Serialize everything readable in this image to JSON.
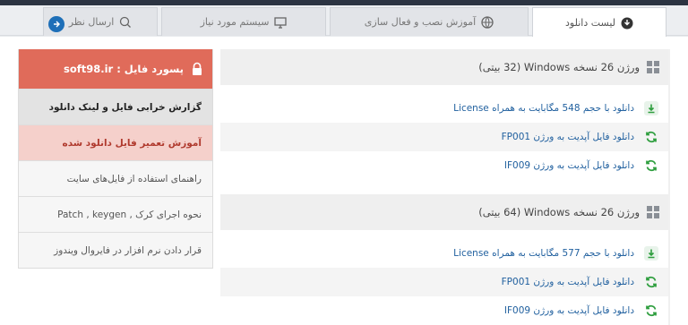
{
  "tabs": [
    {
      "label": "لیست دانلود",
      "icon": "download-circle-icon",
      "active": true
    },
    {
      "label": "آموزش نصب و فعال سازی",
      "icon": "globe-icon",
      "active": false
    },
    {
      "label": "سیستم مورد نیاز",
      "icon": "monitor-icon",
      "active": false
    },
    {
      "label": "ارسال نظر",
      "icon": "chat-icon",
      "active": false
    }
  ],
  "sidebar": {
    "password_label": "پسورد فایل : soft98.ir",
    "items": [
      {
        "label": "گزارش خرابی فایل و لینک دانلود",
        "style": "bold"
      },
      {
        "label": "آموزش تعمیر فایل دانلود شده",
        "style": "pink"
      },
      {
        "label": "راهنمای استفاده از فایل‌های سایت",
        "style": "plain"
      },
      {
        "label": "نحوه اجرای کرک , Patch , keygen",
        "style": "plain"
      },
      {
        "label": "قرار دادن نرم افزار در فایروال ویندوز",
        "style": "plain"
      }
    ]
  },
  "sections": [
    {
      "title": "ورژن 26 نسخه Windows (32 بیتی)",
      "items": [
        {
          "label": "دانلود با حجم 548 مگابایت به همراه License",
          "icon": "download-icon"
        },
        {
          "label": "دانلود فایل آپدیت به ورژن FP001",
          "icon": "refresh-icon"
        },
        {
          "label": "دانلود فایل آپدیت به ورژن IF009",
          "icon": "refresh-icon"
        }
      ]
    },
    {
      "title": "ورژن 26 نسخه Windows (64 بیتی)",
      "items": [
        {
          "label": "دانلود با حجم 577 مگابایت به همراه License",
          "icon": "download-icon"
        },
        {
          "label": "دانلود فایل آپدیت به ورژن FP001",
          "icon": "refresh-icon"
        },
        {
          "label": "دانلود فایل آپدیت به ورژن IF009",
          "icon": "refresh-icon"
        }
      ]
    }
  ],
  "colors": {
    "accent_red": "#e06b5a",
    "link_blue": "#1f5f9e",
    "icon_green": "#2e9e3e"
  }
}
